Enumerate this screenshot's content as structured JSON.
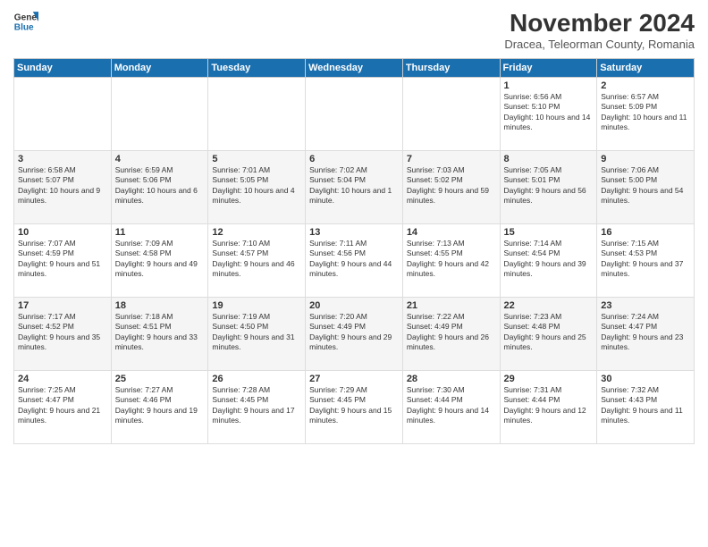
{
  "logo": {
    "line1": "General",
    "line2": "Blue"
  },
  "title": "November 2024",
  "subtitle": "Dracea, Teleorman County, Romania",
  "days_header": [
    "Sunday",
    "Monday",
    "Tuesday",
    "Wednesday",
    "Thursday",
    "Friday",
    "Saturday"
  ],
  "weeks": [
    [
      {
        "day": "",
        "info": ""
      },
      {
        "day": "",
        "info": ""
      },
      {
        "day": "",
        "info": ""
      },
      {
        "day": "",
        "info": ""
      },
      {
        "day": "",
        "info": ""
      },
      {
        "day": "1",
        "info": "Sunrise: 6:56 AM\nSunset: 5:10 PM\nDaylight: 10 hours and 14 minutes."
      },
      {
        "day": "2",
        "info": "Sunrise: 6:57 AM\nSunset: 5:09 PM\nDaylight: 10 hours and 11 minutes."
      }
    ],
    [
      {
        "day": "3",
        "info": "Sunrise: 6:58 AM\nSunset: 5:07 PM\nDaylight: 10 hours and 9 minutes."
      },
      {
        "day": "4",
        "info": "Sunrise: 6:59 AM\nSunset: 5:06 PM\nDaylight: 10 hours and 6 minutes."
      },
      {
        "day": "5",
        "info": "Sunrise: 7:01 AM\nSunset: 5:05 PM\nDaylight: 10 hours and 4 minutes."
      },
      {
        "day": "6",
        "info": "Sunrise: 7:02 AM\nSunset: 5:04 PM\nDaylight: 10 hours and 1 minute."
      },
      {
        "day": "7",
        "info": "Sunrise: 7:03 AM\nSunset: 5:02 PM\nDaylight: 9 hours and 59 minutes."
      },
      {
        "day": "8",
        "info": "Sunrise: 7:05 AM\nSunset: 5:01 PM\nDaylight: 9 hours and 56 minutes."
      },
      {
        "day": "9",
        "info": "Sunrise: 7:06 AM\nSunset: 5:00 PM\nDaylight: 9 hours and 54 minutes."
      }
    ],
    [
      {
        "day": "10",
        "info": "Sunrise: 7:07 AM\nSunset: 4:59 PM\nDaylight: 9 hours and 51 minutes."
      },
      {
        "day": "11",
        "info": "Sunrise: 7:09 AM\nSunset: 4:58 PM\nDaylight: 9 hours and 49 minutes."
      },
      {
        "day": "12",
        "info": "Sunrise: 7:10 AM\nSunset: 4:57 PM\nDaylight: 9 hours and 46 minutes."
      },
      {
        "day": "13",
        "info": "Sunrise: 7:11 AM\nSunset: 4:56 PM\nDaylight: 9 hours and 44 minutes."
      },
      {
        "day": "14",
        "info": "Sunrise: 7:13 AM\nSunset: 4:55 PM\nDaylight: 9 hours and 42 minutes."
      },
      {
        "day": "15",
        "info": "Sunrise: 7:14 AM\nSunset: 4:54 PM\nDaylight: 9 hours and 39 minutes."
      },
      {
        "day": "16",
        "info": "Sunrise: 7:15 AM\nSunset: 4:53 PM\nDaylight: 9 hours and 37 minutes."
      }
    ],
    [
      {
        "day": "17",
        "info": "Sunrise: 7:17 AM\nSunset: 4:52 PM\nDaylight: 9 hours and 35 minutes."
      },
      {
        "day": "18",
        "info": "Sunrise: 7:18 AM\nSunset: 4:51 PM\nDaylight: 9 hours and 33 minutes."
      },
      {
        "day": "19",
        "info": "Sunrise: 7:19 AM\nSunset: 4:50 PM\nDaylight: 9 hours and 31 minutes."
      },
      {
        "day": "20",
        "info": "Sunrise: 7:20 AM\nSunset: 4:49 PM\nDaylight: 9 hours and 29 minutes."
      },
      {
        "day": "21",
        "info": "Sunrise: 7:22 AM\nSunset: 4:49 PM\nDaylight: 9 hours and 26 minutes."
      },
      {
        "day": "22",
        "info": "Sunrise: 7:23 AM\nSunset: 4:48 PM\nDaylight: 9 hours and 25 minutes."
      },
      {
        "day": "23",
        "info": "Sunrise: 7:24 AM\nSunset: 4:47 PM\nDaylight: 9 hours and 23 minutes."
      }
    ],
    [
      {
        "day": "24",
        "info": "Sunrise: 7:25 AM\nSunset: 4:47 PM\nDaylight: 9 hours and 21 minutes."
      },
      {
        "day": "25",
        "info": "Sunrise: 7:27 AM\nSunset: 4:46 PM\nDaylight: 9 hours and 19 minutes."
      },
      {
        "day": "26",
        "info": "Sunrise: 7:28 AM\nSunset: 4:45 PM\nDaylight: 9 hours and 17 minutes."
      },
      {
        "day": "27",
        "info": "Sunrise: 7:29 AM\nSunset: 4:45 PM\nDaylight: 9 hours and 15 minutes."
      },
      {
        "day": "28",
        "info": "Sunrise: 7:30 AM\nSunset: 4:44 PM\nDaylight: 9 hours and 14 minutes."
      },
      {
        "day": "29",
        "info": "Sunrise: 7:31 AM\nSunset: 4:44 PM\nDaylight: 9 hours and 12 minutes."
      },
      {
        "day": "30",
        "info": "Sunrise: 7:32 AM\nSunset: 4:43 PM\nDaylight: 9 hours and 11 minutes."
      }
    ]
  ]
}
